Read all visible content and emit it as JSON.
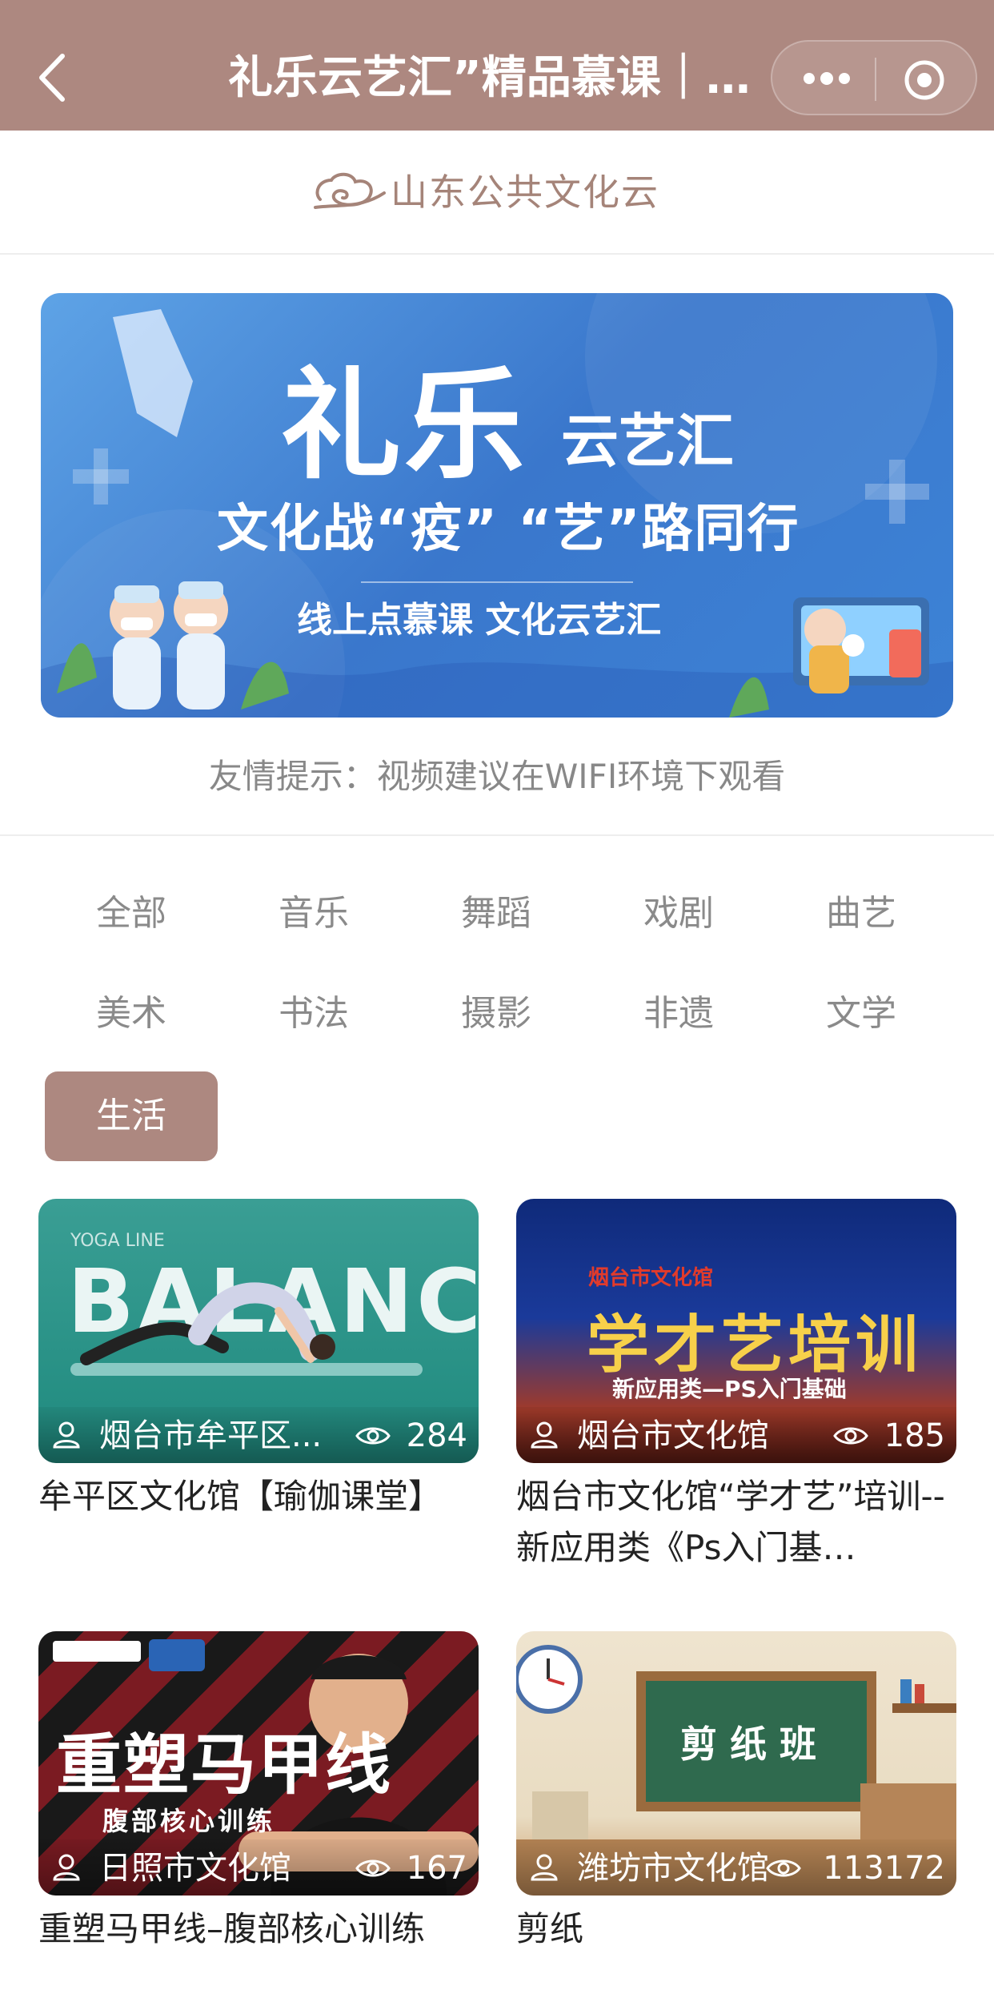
{
  "navbar": {
    "title": "礼乐云艺汇”精品慕课｜…",
    "more_icon": "more-dots-icon",
    "close_icon": "target-circle-icon"
  },
  "brand": {
    "name": "山东公共文化云"
  },
  "banner": {
    "title_big": "礼乐",
    "title_small": "云艺汇",
    "slogan": "文化战“疫”  “艺”路同行",
    "subtitle": "线上点慕课  文化云艺汇"
  },
  "tip": "友情提示：视频建议在WIFI环境下观看",
  "categories": [
    {
      "label": "全部",
      "active": false
    },
    {
      "label": "音乐",
      "active": false
    },
    {
      "label": "舞蹈",
      "active": false
    },
    {
      "label": "戏剧",
      "active": false
    },
    {
      "label": "曲艺",
      "active": false
    },
    {
      "label": "美术",
      "active": false
    },
    {
      "label": "书法",
      "active": false
    },
    {
      "label": "摄影",
      "active": false
    },
    {
      "label": "非遗",
      "active": false
    },
    {
      "label": "文学",
      "active": false
    },
    {
      "label": "生活",
      "active": true
    }
  ],
  "cards": [
    {
      "org": "烟台市牟平区...",
      "views": "284",
      "title": "牟平区文化馆【瑜伽课堂】",
      "thumb_text_1": "YOGA LINE",
      "thumb_text_2": "BALANCE"
    },
    {
      "org": "烟台市文化馆",
      "views": "185",
      "title": "烟台市文化馆“学才艺”培训--新应用类《Ps入门基…",
      "thumb_text_1": "烟台市文化馆",
      "thumb_text_2": "学才艺培训",
      "thumb_text_3": "新应用类—PS入门基础"
    },
    {
      "org": "日照市文化馆",
      "views": "167",
      "title": "重塑马甲线–腹部核心训练",
      "thumb_text_1": "重塑马甲线",
      "thumb_text_2": "腹部核心训练"
    },
    {
      "org": "潍坊市文化馆",
      "views": "113172",
      "title": "剪纸",
      "thumb_text_1": "剪 纸 班"
    }
  ],
  "colors": {
    "accent": "#ad8880",
    "brand": "#a58479"
  }
}
